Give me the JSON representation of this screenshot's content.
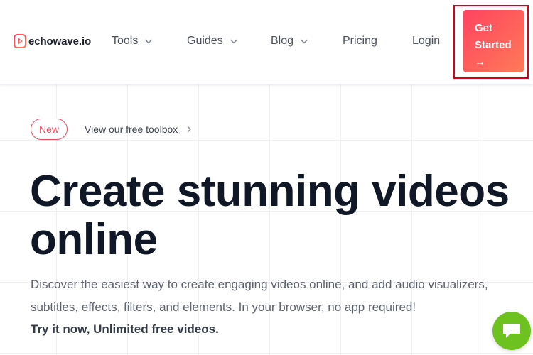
{
  "header": {
    "logo_text": "echowave.io",
    "nav": [
      {
        "label": "Tools",
        "dropdown": true
      },
      {
        "label": "Guides",
        "dropdown": true
      },
      {
        "label": "Blog",
        "dropdown": true
      },
      {
        "label": "Pricing",
        "dropdown": false
      },
      {
        "label": "Login",
        "dropdown": false
      }
    ],
    "cta": {
      "line1": "Get",
      "line2": "Started",
      "arrow": "→"
    }
  },
  "hero": {
    "badge": "New",
    "toolbox_link": "View our free toolbox",
    "title_line1": "Create stunning videos",
    "title_line2": "online",
    "description": "Discover the easiest way to create engaging videos online, and add audio visualizers, subtitles, effects, filters, and elements. In your browser, no app required!",
    "cta_text": "Try it now, Unlimited free videos."
  },
  "colors": {
    "brand_red": "#f0485f",
    "cta_gradient_start": "#ff4360",
    "cta_gradient_end": "#ff7a58",
    "chat_green": "#6dc21f",
    "title_dark": "#101827"
  },
  "icons": {
    "logo": "echowave-play-icon",
    "nav_dropdown": "chevron-down-icon",
    "toolbox_arrow": "chevron-right-icon",
    "chat": "chat-bubble-icon"
  }
}
